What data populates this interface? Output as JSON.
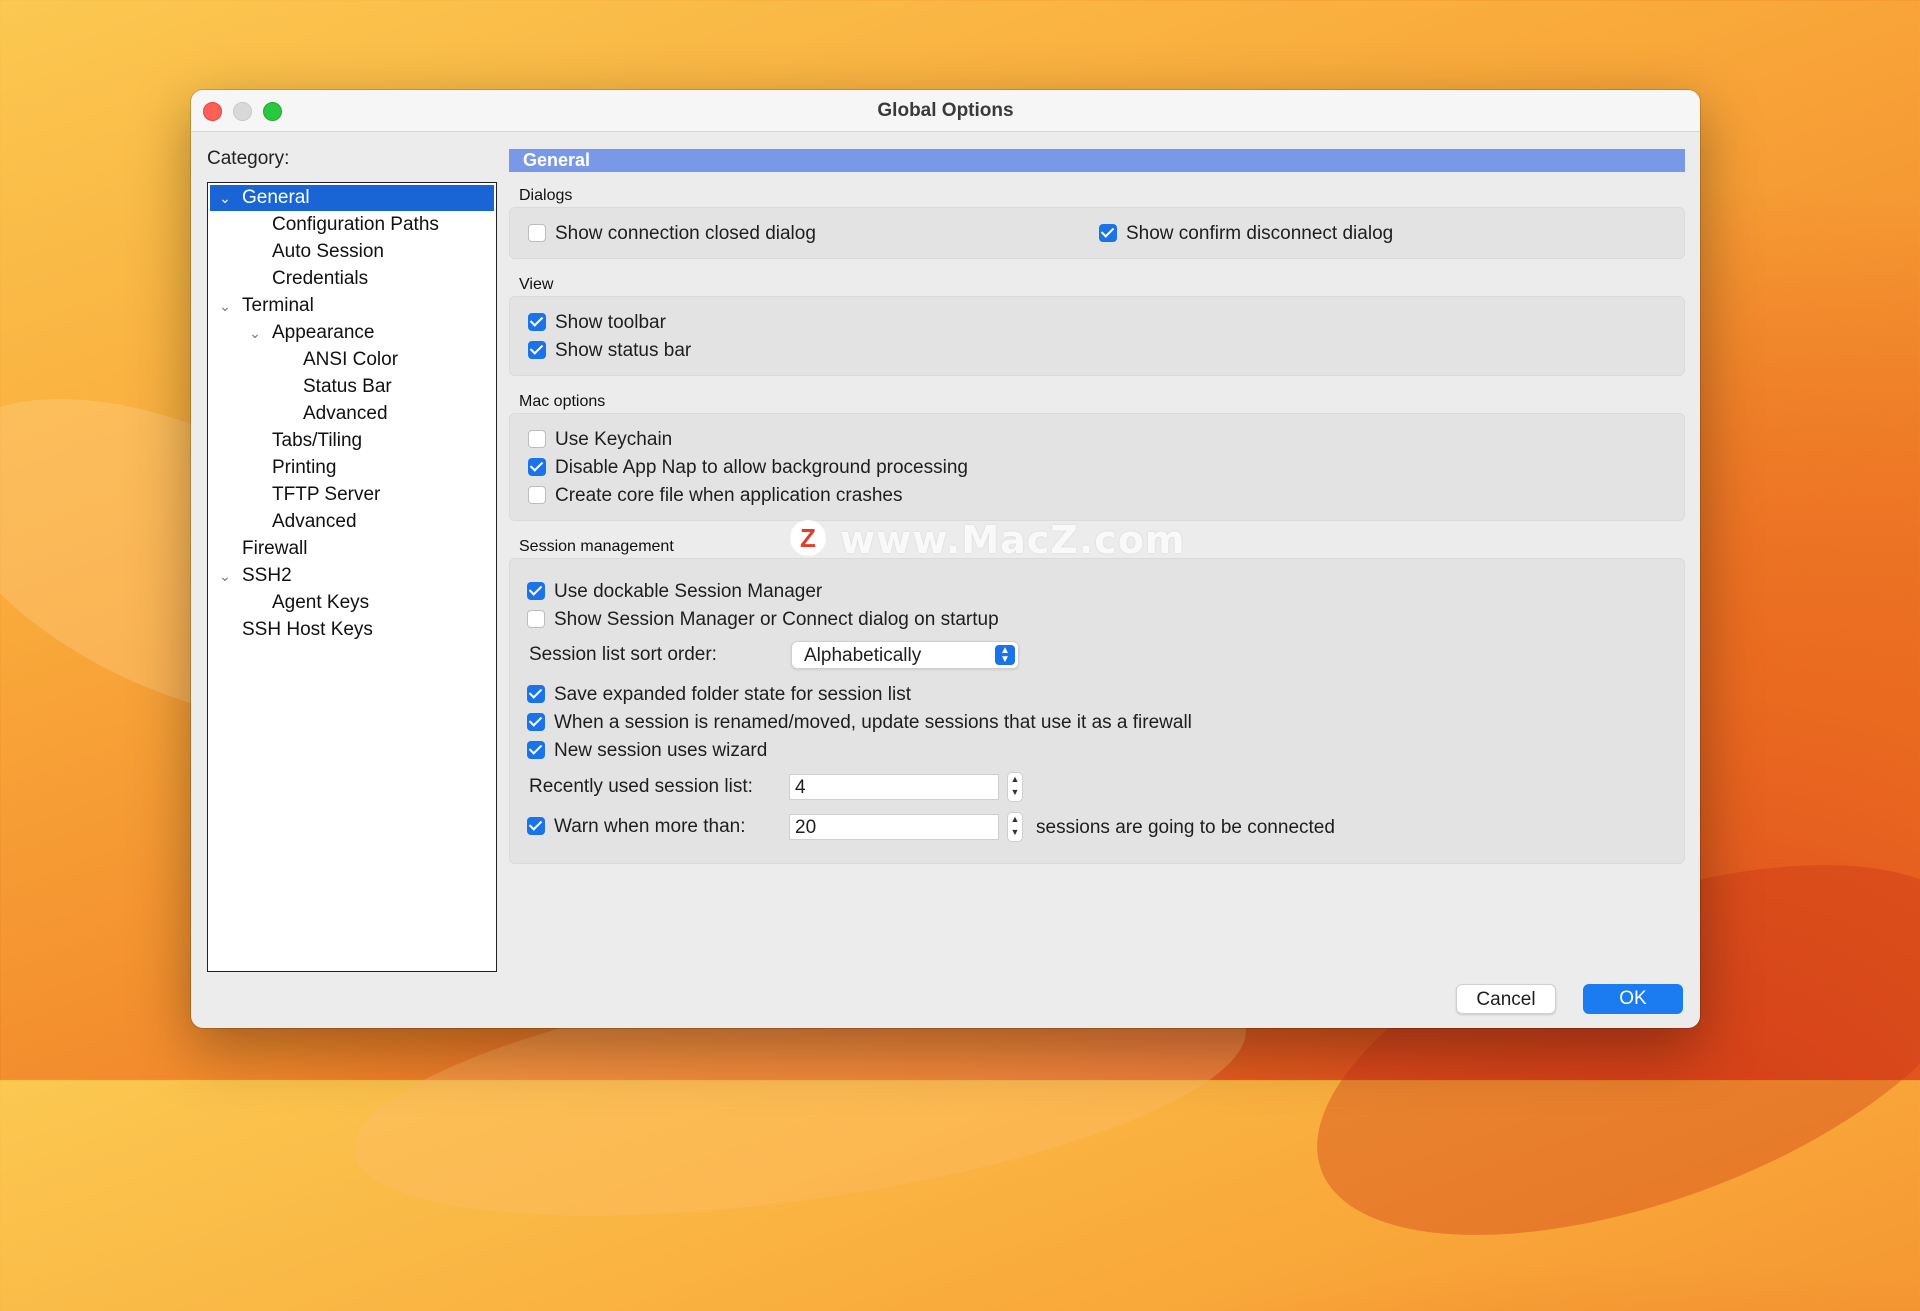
{
  "window": {
    "title": "Global Options"
  },
  "category": {
    "label": "Category:",
    "items": [
      {
        "label": "General",
        "level": 0,
        "expanded": true,
        "selected": true
      },
      {
        "label": "Configuration Paths",
        "level": 1
      },
      {
        "label": "Auto Session",
        "level": 1
      },
      {
        "label": "Credentials",
        "level": 1
      },
      {
        "label": "Terminal",
        "level": 0,
        "expanded": true
      },
      {
        "label": "Appearance",
        "level": 1,
        "expanded": true
      },
      {
        "label": "ANSI Color",
        "level": 2
      },
      {
        "label": "Status Bar",
        "level": 2
      },
      {
        "label": "Advanced",
        "level": 2
      },
      {
        "label": "Tabs/Tiling",
        "level": 1
      },
      {
        "label": "Printing",
        "level": 1
      },
      {
        "label": "TFTP Server",
        "level": 1
      },
      {
        "label": "Advanced",
        "level": 1
      },
      {
        "label": "Firewall",
        "level": 0
      },
      {
        "label": "SSH2",
        "level": 0,
        "expanded": true
      },
      {
        "label": "Agent Keys",
        "level": 1
      },
      {
        "label": "SSH Host Keys",
        "level": 0
      }
    ]
  },
  "panel": {
    "header": "General",
    "dialogs": {
      "title": "Dialogs",
      "show_connection_closed": {
        "label": "Show connection closed dialog",
        "checked": false
      },
      "show_confirm_disconnect": {
        "label": "Show confirm disconnect dialog",
        "checked": true
      }
    },
    "view": {
      "title": "View",
      "show_toolbar": {
        "label": "Show toolbar",
        "checked": true
      },
      "show_status_bar": {
        "label": "Show status bar",
        "checked": true
      }
    },
    "mac_options": {
      "title": "Mac options",
      "use_keychain": {
        "label": "Use Keychain",
        "checked": false
      },
      "disable_app_nap": {
        "label": "Disable App Nap to allow background processing",
        "checked": true
      },
      "create_core_file": {
        "label": "Create core file when application crashes",
        "checked": false
      }
    },
    "session_management": {
      "title": "Session management",
      "dockable": {
        "label": "Use dockable Session Manager",
        "checked": true
      },
      "show_on_startup": {
        "label": "Show Session Manager or Connect dialog on startup",
        "checked": false
      },
      "sort_order_label": "Session list sort order:",
      "sort_order_value": "Alphabetically",
      "save_folder_state": {
        "label": "Save expanded folder state for session list",
        "checked": true
      },
      "update_firewall": {
        "label": "When a session is renamed/moved, update sessions that use it as a firewall",
        "checked": true
      },
      "wizard": {
        "label": "New session uses wizard",
        "checked": true
      },
      "recent_label": "Recently used session list:",
      "recent_value": "4",
      "warn": {
        "label": "Warn when more than:",
        "checked": true
      },
      "warn_value": "20",
      "warn_suffix": "sessions are going to be connected"
    }
  },
  "buttons": {
    "cancel": "Cancel",
    "ok": "OK"
  },
  "watermark": {
    "logo": "Z",
    "text": "www.MacZ.com"
  },
  "colors": {
    "accent": "#1a73e8",
    "header": "#7a98e8",
    "selection": "#1a65d6"
  },
  "icons": {
    "expanded": "chevron-down-icon",
    "stepper": "stepper-icon",
    "popup": "popup-arrows-icon"
  }
}
